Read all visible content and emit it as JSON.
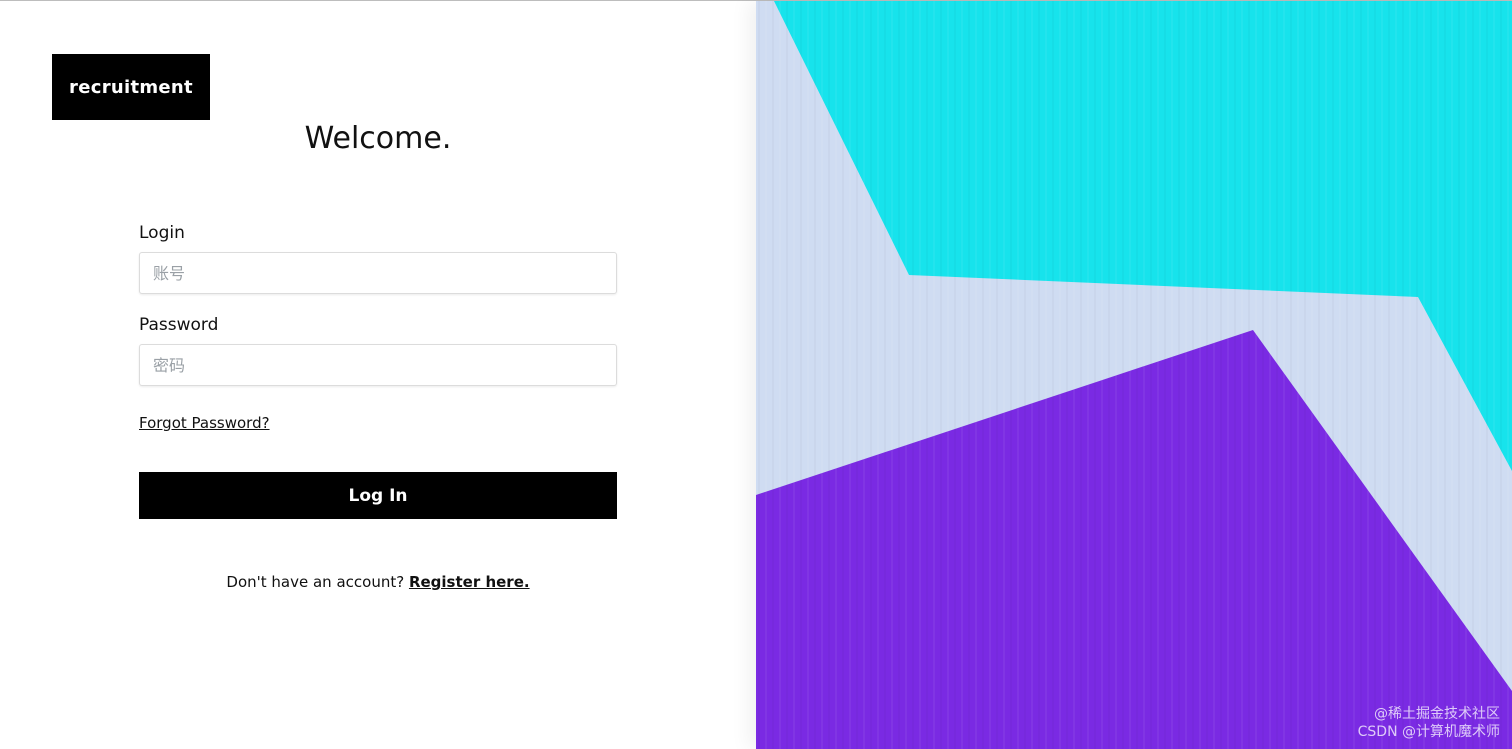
{
  "brand": {
    "logo_text": "recruitment"
  },
  "form": {
    "heading": "Welcome.",
    "login_label": "Login",
    "login_placeholder": "账号",
    "password_label": "Password",
    "password_placeholder": "密码",
    "forgot_link": "Forgot Password?",
    "submit_label": "Log In",
    "register_prompt": "Don't have an account? ",
    "register_link": "Register here."
  },
  "artwork": {
    "colors": {
      "background": "#cfdcf2",
      "cyan": "#17e3ec",
      "purple": "#7a2ae3"
    }
  },
  "watermark": {
    "line1": "@稀土掘金技术社区",
    "line2": "CSDN @计算机魔术师"
  }
}
